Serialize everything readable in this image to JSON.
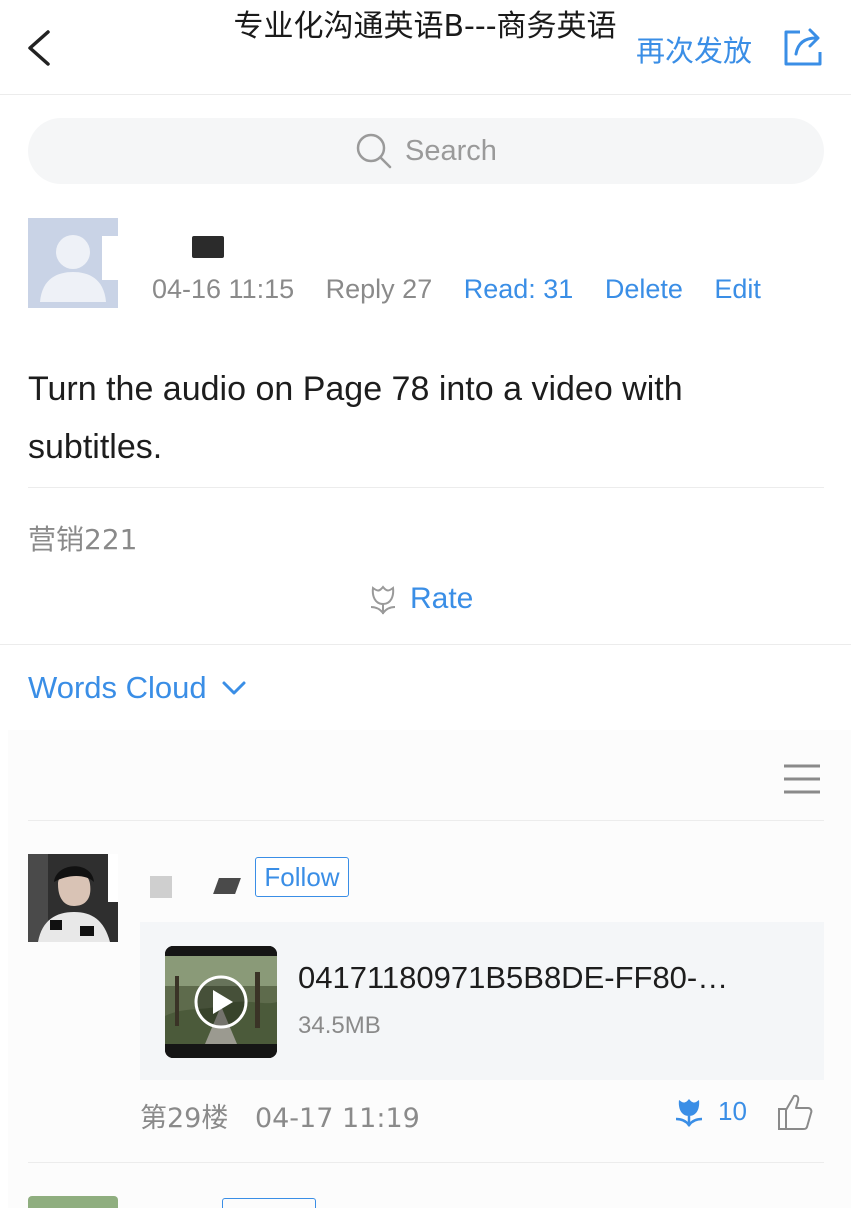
{
  "header": {
    "title": "专业化沟通英语B---商务英语",
    "repost_label": "再次发放"
  },
  "search": {
    "placeholder": "Search"
  },
  "post": {
    "time": "04-16 11:15",
    "reply": "Reply 27",
    "read": "Read: 31",
    "delete_label": "Delete",
    "edit_label": "Edit",
    "body": "Turn the audio on Page 78 into a video with subtitles.",
    "tag": "营销221",
    "rate_label": "Rate"
  },
  "words_cloud": {
    "label": "Words Cloud"
  },
  "reply_item": {
    "follow_label": "Follow",
    "attachment": {
      "name": "04171180971B5B8DE-FF80-…",
      "size": "34.5MB"
    },
    "floor": "第29楼",
    "time": "04-17 11:19",
    "flower_count": "10"
  },
  "colors": {
    "accent": "#3a8ee6",
    "muted": "#8a8a8a",
    "divider": "#ececec"
  },
  "icons": {
    "back": "chevron-left-icon",
    "share": "share-icon",
    "search": "search-icon",
    "rate": "flower-icon",
    "words_cloud": "chevron-down-icon",
    "menu": "hamburger-icon",
    "play": "play-icon",
    "like": "thumbs-up-icon"
  }
}
